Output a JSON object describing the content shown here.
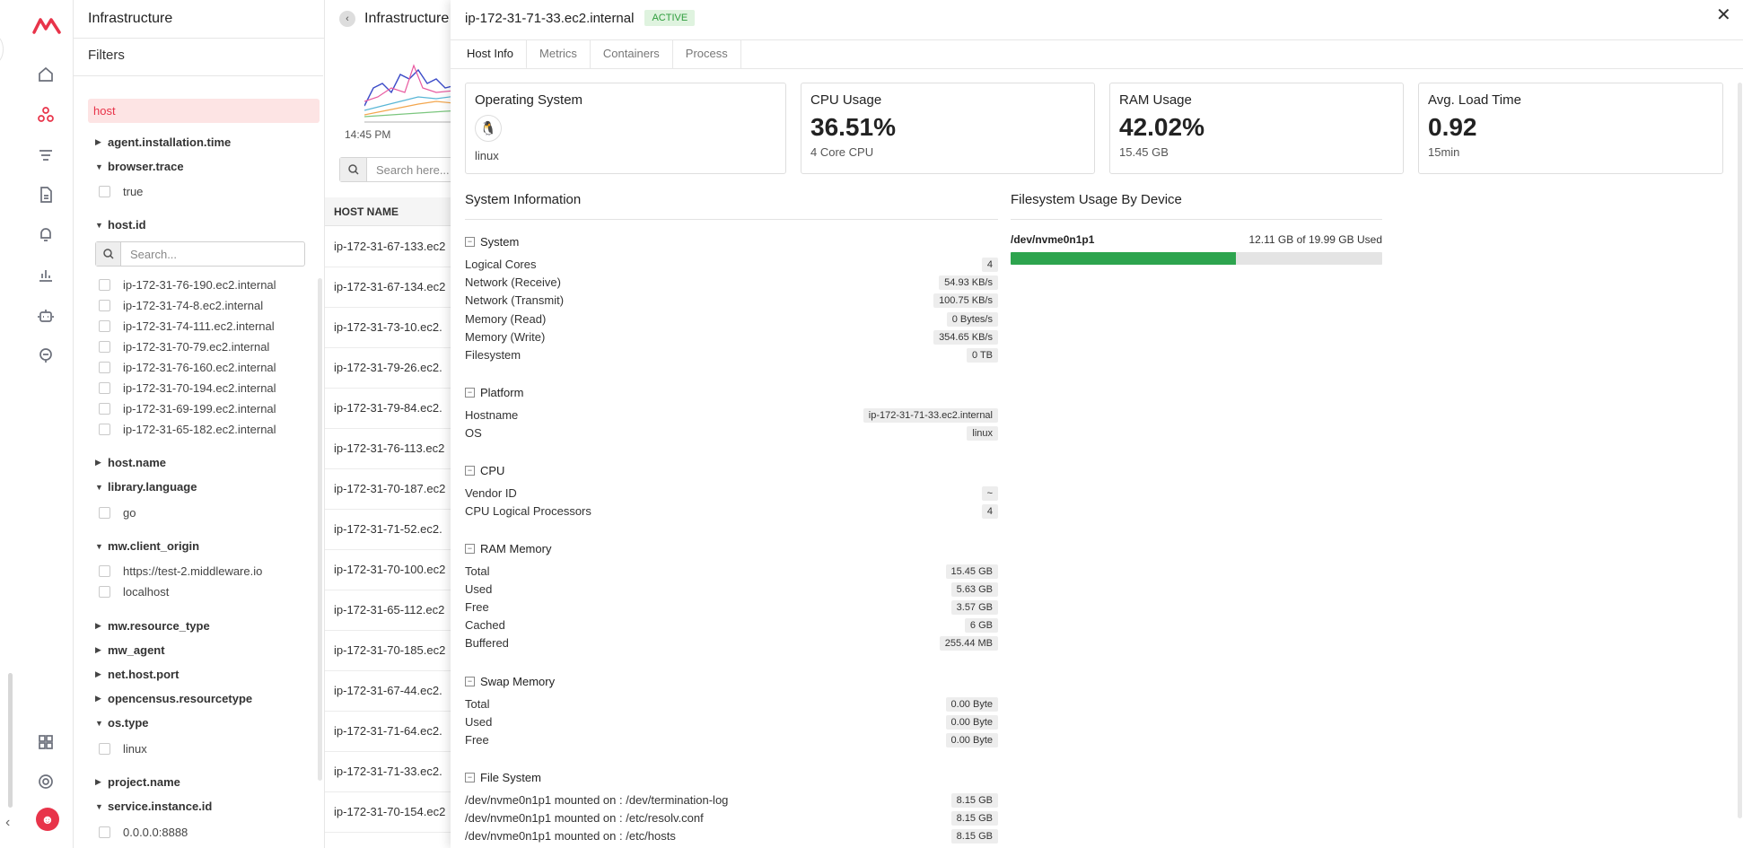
{
  "sidebar": {
    "logo": "middleware-logo",
    "icons": [
      "home-icon",
      "infrastructure-icon",
      "logs-icon",
      "document-icon",
      "bell-icon",
      "chart-icon",
      "robot-icon",
      "support-icon",
      "grid-icon",
      "gear-icon"
    ],
    "active": "infrastructure-icon"
  },
  "filters_panel": {
    "title": "Infrastructure",
    "filters_title": "Filters",
    "search_chip": "host",
    "groups": [
      {
        "label": "agent.installation.time",
        "expanded": false
      },
      {
        "label": "browser.trace",
        "expanded": true,
        "options": [
          "true"
        ]
      },
      {
        "label": "host.id",
        "expanded": true,
        "search_placeholder": "Search...",
        "options": [
          "ip-172-31-76-190.ec2.internal",
          "ip-172-31-74-8.ec2.internal",
          "ip-172-31-74-111.ec2.internal",
          "ip-172-31-70-79.ec2.internal",
          "ip-172-31-76-160.ec2.internal",
          "ip-172-31-70-194.ec2.internal",
          "ip-172-31-69-199.ec2.internal",
          "ip-172-31-65-182.ec2.internal"
        ]
      },
      {
        "label": "host.name",
        "expanded": false
      },
      {
        "label": "library.language",
        "expanded": true,
        "options": [
          "go"
        ]
      },
      {
        "label": "mw.client_origin",
        "expanded": true,
        "options": [
          "https://test-2.middleware.io",
          "localhost"
        ]
      },
      {
        "label": "mw.resource_type",
        "expanded": false
      },
      {
        "label": "mw_agent",
        "expanded": false
      },
      {
        "label": "net.host.port",
        "expanded": false
      },
      {
        "label": "opencensus.resourcetype",
        "expanded": false
      },
      {
        "label": "os.type",
        "expanded": true,
        "options": [
          "linux"
        ]
      },
      {
        "label": "project.name",
        "expanded": false
      },
      {
        "label": "service.instance.id",
        "expanded": true,
        "options": [
          "0.0.0.0:8888"
        ]
      }
    ]
  },
  "background": {
    "breadcrumb": "Infrastructure",
    "breadcrumb_sep": ">",
    "time_label": "14:45 PM",
    "search_placeholder": "Search here...",
    "column_header": "HOST NAME",
    "rows": [
      "ip-172-31-67-133.ec2",
      "ip-172-31-67-134.ec2",
      "ip-172-31-73-10.ec2.",
      "ip-172-31-79-26.ec2.",
      "ip-172-31-79-84.ec2.",
      "ip-172-31-76-113.ec2",
      "ip-172-31-70-187.ec2",
      "ip-172-31-71-52.ec2.",
      "ip-172-31-70-100.ec2",
      "ip-172-31-65-112.ec2",
      "ip-172-31-70-185.ec2",
      "ip-172-31-67-44.ec2.",
      "ip-172-31-71-64.ec2.",
      "ip-172-31-71-33.ec2.",
      "ip-172-31-70-154.ec2"
    ]
  },
  "drawer": {
    "title": "ip-172-31-71-33.ec2.internal",
    "status": "ACTIVE",
    "close": "✕",
    "tabs": [
      "Host Info",
      "Metrics",
      "Containers",
      "Process"
    ],
    "active_tab": "Host Info",
    "cards": {
      "os": {
        "title": "Operating System",
        "icon": "linux-icon",
        "value": "linux"
      },
      "cpu": {
        "title": "CPU Usage",
        "value": "36.51%",
        "sub": "4 Core CPU"
      },
      "ram": {
        "title": "RAM Usage",
        "value": "42.02%",
        "sub": "15.45 GB"
      },
      "load": {
        "title": "Avg. Load Time",
        "value": "0.92",
        "sub": "15min"
      }
    },
    "sysinfo_title": "System Information",
    "fs_title": "Filesystem Usage By Device",
    "fs_device": "/dev/nvme0n1p1",
    "fs_used_text": "12.11 GB of 19.99 GB Used",
    "fs_used_fraction": 0.606,
    "sections": [
      {
        "name": "System",
        "rows": [
          [
            "Logical Cores",
            "4"
          ],
          [
            "Network (Receive)",
            "54.93 KB/s"
          ],
          [
            "Network (Transmit)",
            "100.75 KB/s"
          ],
          [
            "Memory (Read)",
            "0 Bytes/s"
          ],
          [
            "Memory (Write)",
            "354.65 KB/s"
          ],
          [
            "Filesystem",
            "0 TB"
          ]
        ]
      },
      {
        "name": "Platform",
        "rows": [
          [
            "Hostname",
            "ip-172-31-71-33.ec2.internal"
          ],
          [
            "OS",
            "linux"
          ]
        ]
      },
      {
        "name": "CPU",
        "rows": [
          [
            "Vendor ID",
            "~"
          ],
          [
            "CPU Logical Processors",
            "4"
          ]
        ]
      },
      {
        "name": "RAM Memory",
        "rows": [
          [
            "Total",
            "15.45 GB"
          ],
          [
            "Used",
            "5.63 GB"
          ],
          [
            "Free",
            "3.57 GB"
          ],
          [
            "Cached",
            "6 GB"
          ],
          [
            "Buffered",
            "255.44 MB"
          ]
        ]
      },
      {
        "name": "Swap Memory",
        "rows": [
          [
            "Total",
            "0.00 Byte"
          ],
          [
            "Used",
            "0.00 Byte"
          ],
          [
            "Free",
            "0.00 Byte"
          ]
        ]
      },
      {
        "name": "File System",
        "rows": [
          [
            "/dev/nvme0n1p1 mounted on : /dev/termination-log",
            "8.15 GB"
          ],
          [
            "/dev/nvme0n1p1 mounted on : /etc/resolv.conf",
            "8.15 GB"
          ],
          [
            "/dev/nvme0n1p1 mounted on : /etc/hosts",
            "8.15 GB"
          ]
        ]
      }
    ]
  }
}
